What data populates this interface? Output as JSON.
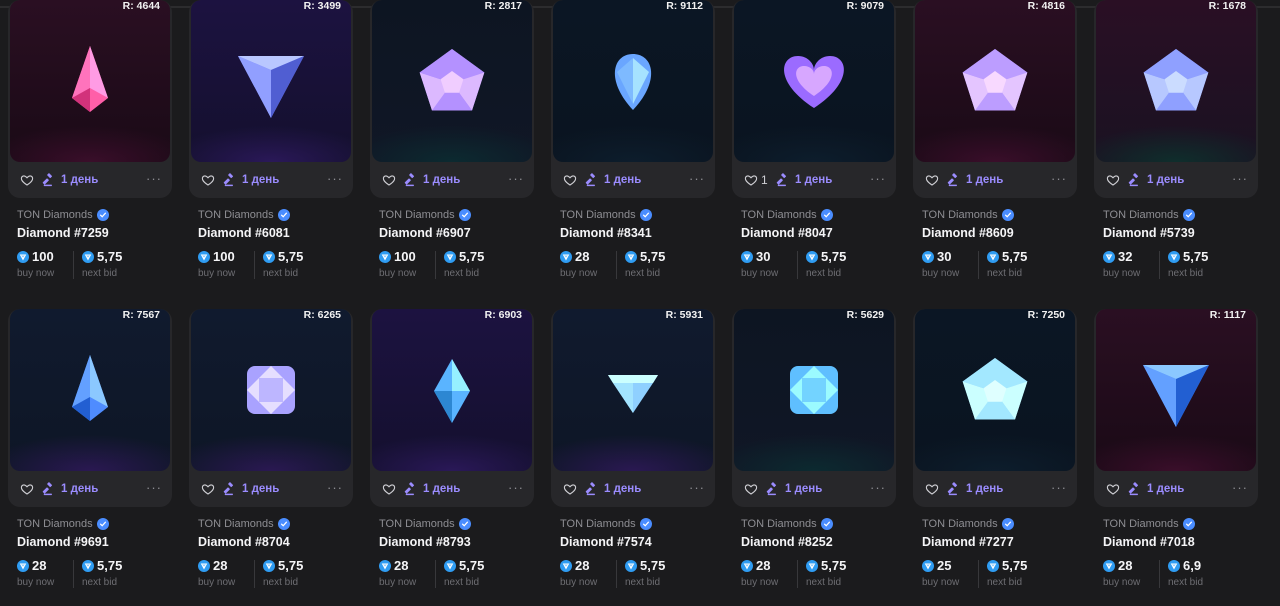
{
  "ui": {
    "buy_caption": "buy now",
    "bid_caption": "next bid",
    "more_glyph": "···",
    "accent_color": "#9b8cff",
    "verified_color": "#4a8dff",
    "ton_color": "#2f9cf2"
  },
  "cards": [
    {
      "rarity": "R: 4644",
      "collection": "TON Diamonds",
      "name": "Diamond #7259",
      "buy_now": "100",
      "next_bid": "5,75",
      "likes": "",
      "auction": "1 день",
      "gem_shape": "shard",
      "gem_color": "#ff5fa8",
      "bg": "pink"
    },
    {
      "rarity": "R: 3499",
      "collection": "TON Diamonds",
      "name": "Diamond #6081",
      "buy_now": "100",
      "next_bid": "5,75",
      "likes": "",
      "auction": "1 день",
      "gem_shape": "triangle",
      "gem_color": "#7d8bff",
      "bg": "purple"
    },
    {
      "rarity": "R: 2817",
      "collection": "TON Diamonds",
      "name": "Diamond #6907",
      "buy_now": "100",
      "next_bid": "5,75",
      "likes": "",
      "auction": "1 день",
      "gem_shape": "pentagon",
      "gem_color": "#a07dff",
      "bg": "teal"
    },
    {
      "rarity": "R: 9112",
      "collection": "TON Diamonds",
      "name": "Diamond #8341",
      "buy_now": "28",
      "next_bid": "5,75",
      "likes": "",
      "auction": "1 день",
      "gem_shape": "drop",
      "gem_color": "#6aa6ff",
      "bg": "navy"
    },
    {
      "rarity": "R: 9079",
      "collection": "TON Diamonds",
      "name": "Diamond #8047",
      "buy_now": "30",
      "next_bid": "5,75",
      "likes": "1",
      "auction": "1 день",
      "gem_shape": "heart",
      "gem_color": "#9b6bff",
      "bg": "navy"
    },
    {
      "rarity": "R: 4816",
      "collection": "TON Diamonds",
      "name": "Diamond #8609",
      "buy_now": "30",
      "next_bid": "5,75",
      "likes": "",
      "auction": "1 день",
      "gem_shape": "pentagon",
      "gem_color": "#a889ff",
      "bg": "pink"
    },
    {
      "rarity": "R: 1678",
      "collection": "TON Diamonds",
      "name": "Diamond #5739",
      "buy_now": "32",
      "next_bid": "5,75",
      "likes": "",
      "auction": "1 день",
      "gem_shape": "pentagon",
      "gem_color": "#7b8cff",
      "bg": "tealpink"
    },
    {
      "rarity": "R: 7567",
      "collection": "TON Diamonds",
      "name": "Diamond #9691",
      "buy_now": "28",
      "next_bid": "5,75",
      "likes": "",
      "auction": "1 день",
      "gem_shape": "shard",
      "gem_color": "#4f8cff",
      "bg": "navypurple"
    },
    {
      "rarity": "R: 6265",
      "collection": "TON Diamonds",
      "name": "Diamond #8704",
      "buy_now": "28",
      "next_bid": "5,75",
      "likes": "",
      "auction": "1 день",
      "gem_shape": "cushion",
      "gem_color": "#a9a2ff",
      "bg": "navypurple"
    },
    {
      "rarity": "R: 6903",
      "collection": "TON Diamonds",
      "name": "Diamond #8793",
      "buy_now": "28",
      "next_bid": "5,75",
      "likes": "",
      "auction": "1 день",
      "gem_shape": "rhombus",
      "gem_color": "#5ab4ff",
      "bg": "purple"
    },
    {
      "rarity": "R: 5931",
      "collection": "TON Diamonds",
      "name": "Diamond #7574",
      "buy_now": "28",
      "next_bid": "5,75",
      "likes": "",
      "auction": "1 день",
      "gem_shape": "brilliant",
      "gem_color": "#8fd0ff",
      "bg": "navypurple"
    },
    {
      "rarity": "R: 5629",
      "collection": "TON Diamonds",
      "name": "Diamond #8252",
      "buy_now": "28",
      "next_bid": "5,75",
      "likes": "",
      "auction": "1 день",
      "gem_shape": "cushion",
      "gem_color": "#5fbfff",
      "bg": "teal"
    },
    {
      "rarity": "R: 7250",
      "collection": "TON Diamonds",
      "name": "Diamond #7277",
      "buy_now": "25",
      "next_bid": "5,75",
      "likes": "",
      "auction": "1 день",
      "gem_shape": "pentagon",
      "gem_color": "#8fd4ff",
      "bg": "navy"
    },
    {
      "rarity": "R: 1117",
      "collection": "TON Diamonds",
      "name": "Diamond #7018",
      "buy_now": "28",
      "next_bid": "6,9",
      "likes": "",
      "auction": "1 день",
      "gem_shape": "triangle",
      "gem_color": "#4f8cff",
      "bg": "pink"
    }
  ]
}
